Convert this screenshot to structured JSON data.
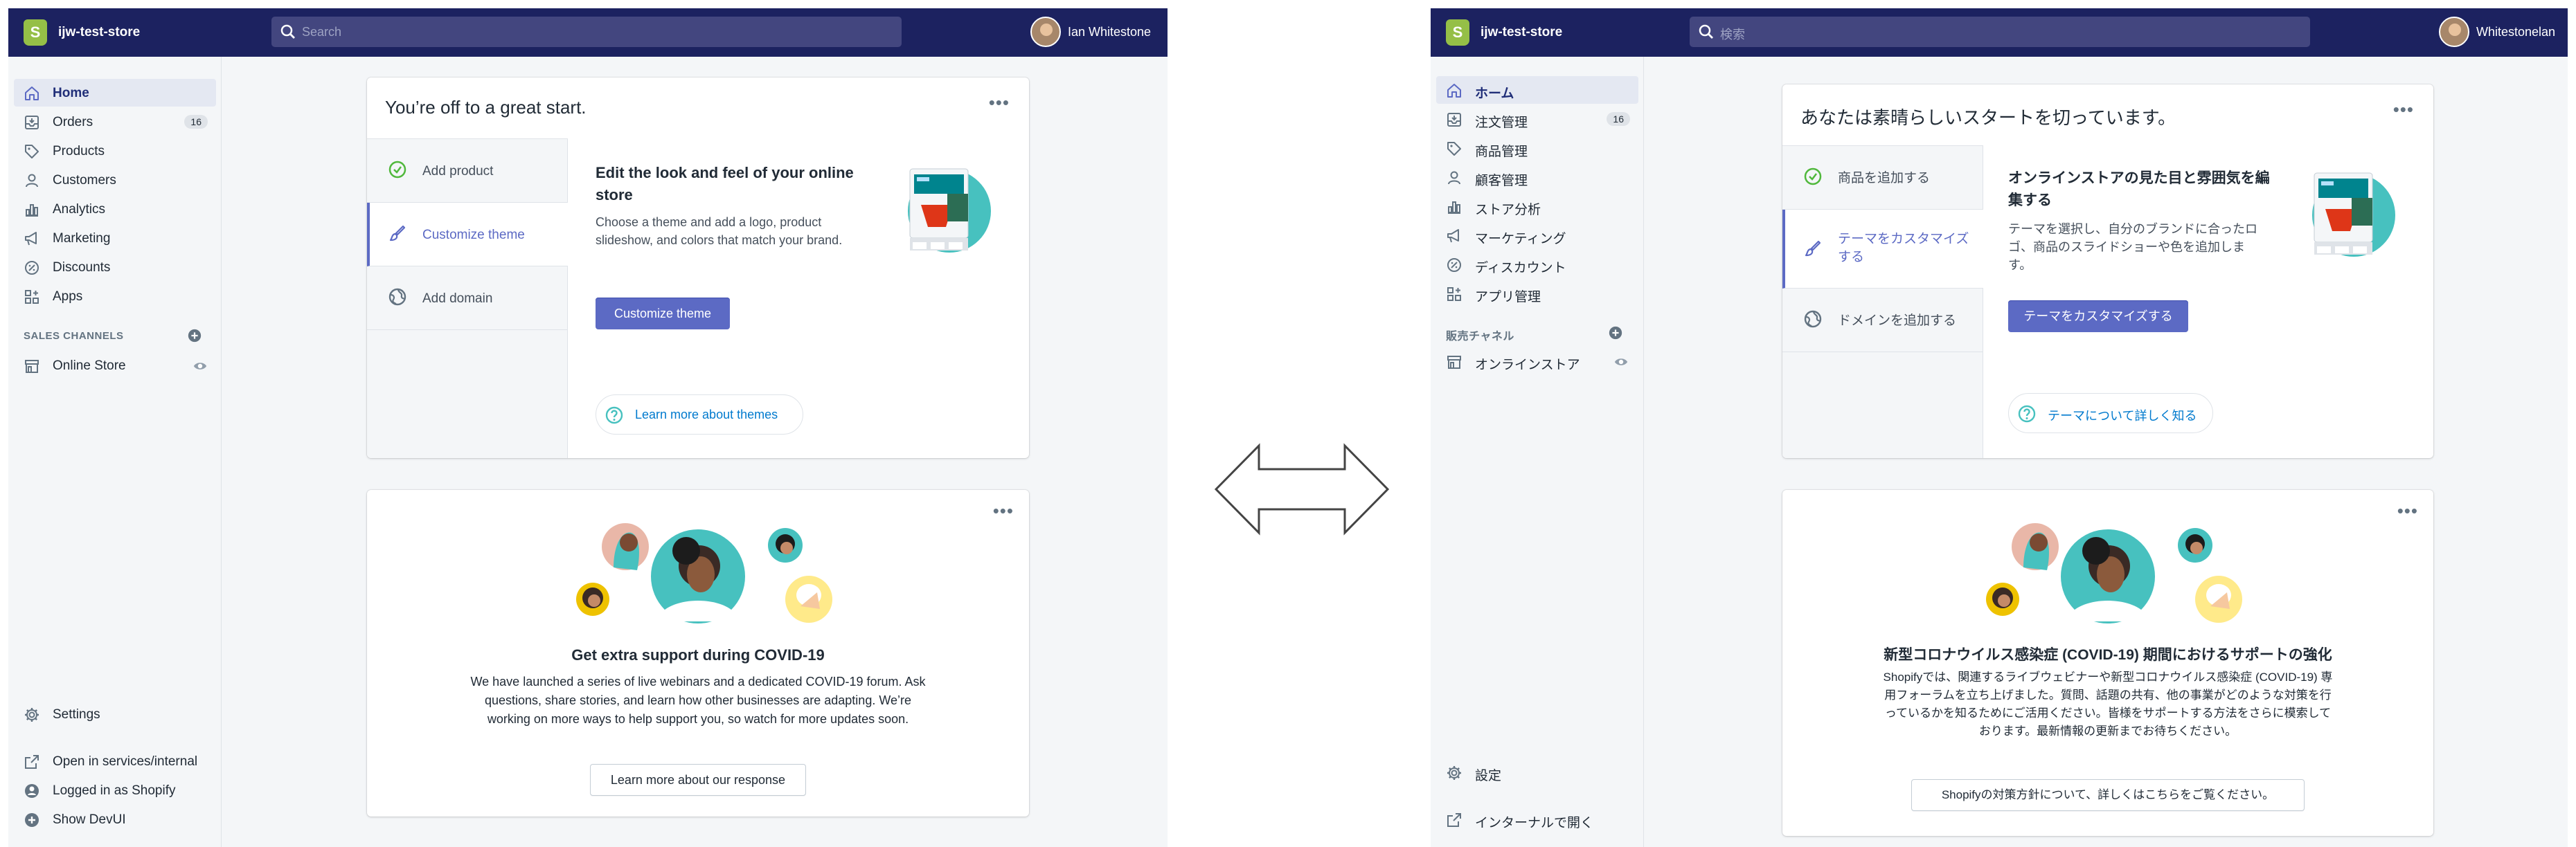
{
  "colors": {
    "topbar": "#1c2260",
    "accent": "#5c6ac4",
    "link": "#007ace",
    "success": "#50b83c",
    "sidebar": "#f4f6f8"
  },
  "left": {
    "store": "ijw-test-store",
    "search_placeholder": "Search",
    "user": "Ian Whitestone",
    "nav": [
      {
        "label": "Home",
        "icon": "home-icon"
      },
      {
        "label": "Orders",
        "icon": "orders-icon",
        "badge": "16"
      },
      {
        "label": "Products",
        "icon": "tag-icon"
      },
      {
        "label": "Customers",
        "icon": "person-icon"
      },
      {
        "label": "Analytics",
        "icon": "bar-chart-icon"
      },
      {
        "label": "Marketing",
        "icon": "megaphone-icon"
      },
      {
        "label": "Discounts",
        "icon": "discount-icon"
      },
      {
        "label": "Apps",
        "icon": "apps-icon"
      }
    ],
    "sales_channels": "SALES CHANNELS",
    "online_store": "Online Store",
    "settings": "Settings",
    "bottom": [
      "Open in services/internal",
      "Logged in as Shopify",
      "Show DevUI"
    ],
    "card1": {
      "title": "You’re off to a great start.",
      "tabs": [
        "Add product",
        "Customize theme",
        "Add domain"
      ],
      "heading": "Edit the look and feel of your online store",
      "body": "Choose a theme and add a logo, product slideshow, and colors that match your brand.",
      "button": "Customize theme",
      "learn": "Learn more about themes"
    },
    "card2": {
      "heading": "Get extra support during COVID-19",
      "body": "We have launched a series of live webinars and a dedicated COVID-19 forum. Ask questions, share stories, and learn how other businesses are adapting. We’re working on more ways to help support you, so watch for more updates soon.",
      "button": "Learn more about our response"
    }
  },
  "right": {
    "store": "ijw-test-store",
    "search_placeholder": "検索",
    "user": "Whitestonelan",
    "nav": [
      {
        "label": "ホーム",
        "icon": "home-icon"
      },
      {
        "label": "注文管理",
        "icon": "orders-icon",
        "badge": "16"
      },
      {
        "label": "商品管理",
        "icon": "tag-icon"
      },
      {
        "label": "顧客管理",
        "icon": "person-icon"
      },
      {
        "label": "ストア分析",
        "icon": "bar-chart-icon"
      },
      {
        "label": "マーケティング",
        "icon": "megaphone-icon"
      },
      {
        "label": "ディスカウント",
        "icon": "discount-icon"
      },
      {
        "label": "アプリ管理",
        "icon": "apps-icon"
      }
    ],
    "sales_channels": "販売チャネル",
    "online_store": "オンラインストア",
    "settings": "設定",
    "bottom": [
      "インターナルで開く"
    ],
    "card1": {
      "title": "あなたは素晴らしいスタートを切っています。",
      "tabs": [
        "商品を追加する",
        "テーマをカスタマイズする",
        "ドメインを追加する"
      ],
      "heading": "オンラインストアの見た目と雰囲気を編集する",
      "body": "テーマを選択し、自分のブランドに合ったロゴ、商品のスライドショーや色を追加します。",
      "button": "テーマをカスタマイズする",
      "learn": "テーマについて詳しく知る"
    },
    "card2": {
      "heading": "新型コロナウイルス感染症 (COVID-19) 期間におけるサポートの強化",
      "body": "Shopifyでは、関連するライブウェビナーや新型コロナウイルス感染症 (COVID-19) 専用フォーラムを立ち上げました。質問、話題の共有、他の事業がどのような対策を行っているかを知るためにご活用ください。皆様をサポートする方法をさらに模索しております。最新情報の更新までお待ちください。",
      "button": "Shopifyの対策方針について、詳しくはこちらをご覧ください。"
    }
  }
}
